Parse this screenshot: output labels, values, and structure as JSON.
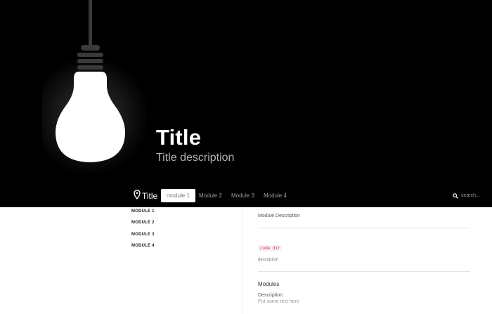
{
  "hero": {
    "title": "Title",
    "description": "Title description"
  },
  "navbar": {
    "brand_label": "Title",
    "brand_icon": "map-pin-icon",
    "tabs": [
      {
        "label": "module 1",
        "active": true
      },
      {
        "label": "Module 2",
        "active": false
      },
      {
        "label": "Module 3",
        "active": false
      },
      {
        "label": "Module 4",
        "active": false
      }
    ],
    "search": {
      "placeholder": "search...",
      "icon": "search-icon"
    }
  },
  "sidebar": {
    "items": [
      {
        "label": "MODULE 1"
      },
      {
        "label": "MODULE 2"
      },
      {
        "label": "MODULE 3"
      },
      {
        "label": "MODULE 4"
      }
    ]
  },
  "main": {
    "module_description": "Module Description",
    "code_label": "code dir",
    "small_description": "description",
    "modules_heading": "Modules",
    "description_label": "Description",
    "placeholder_text": "Put some text here"
  },
  "colors": {
    "hero_background": "#000000",
    "active_tab_background": "#ffffff",
    "code_text": "#c7254e"
  }
}
